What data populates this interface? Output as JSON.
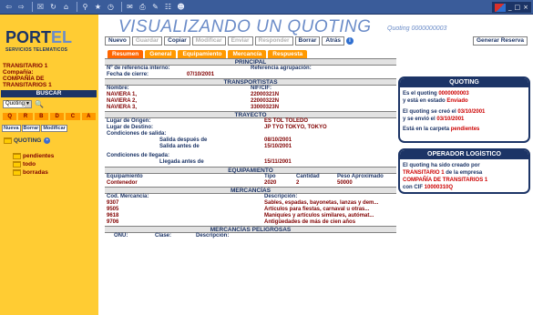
{
  "browser": {
    "toolbar_icons": [
      "back-icon",
      "forward-icon",
      "stop-icon",
      "refresh-icon",
      "home-icon",
      "search-icon",
      "favorites-icon",
      "history-icon",
      "mail-icon",
      "print-icon",
      "edit-icon",
      "discuss-icon",
      "messenger-icon"
    ],
    "window_controls": [
      "_",
      "□",
      "×"
    ]
  },
  "sidebar": {
    "logo_text_1": "PORT",
    "logo_text_2": "EL",
    "logo_subtitle": "SERVICIOS TELEMATICOS",
    "user_line1": "TRANSITARIO 1",
    "user_line2": "Compañía:",
    "user_line3": "COMPAÑÍA DE",
    "user_line4": "TRANSITARIOS 1",
    "buscar_label": "BUSCAR",
    "search_select_value": "Quotings",
    "letters": [
      "Q",
      "R",
      "B",
      "D",
      "C",
      "A"
    ],
    "buttons": [
      "Nueva",
      "Borrar",
      "Modificar"
    ],
    "tree_root": "QUOTING",
    "tree_items": [
      "pendientes",
      "todo",
      "borradas"
    ]
  },
  "header": {
    "title": "VISUALIZANDO UN QUOTING",
    "quoting_number": "Quoting 0000000003"
  },
  "actions": {
    "nuevo": "Nuevo",
    "guardar": "Guardar",
    "copiar": "Copiar",
    "modificar": "Modificar",
    "enviar": "Enviar",
    "responder": "Responder",
    "borrar": "Borrar",
    "atras": "Atrás",
    "info": "i",
    "generar_reserva": "Generar Reserva"
  },
  "tabs": [
    "Resumen",
    "General",
    "Equipamiento",
    "Mercancía",
    "Respuesta"
  ],
  "main": {
    "principal": {
      "header": "PRINCIPAL",
      "ref_interno_label": "Nº de referencia interno:",
      "ref_agrupacion_label": "Referencia agrupación:",
      "fecha_cierre_label": "Fecha de cierre:",
      "fecha_cierre_value": "07/10/2001"
    },
    "transportistas": {
      "header": "TRANSPORTISTAS",
      "col_nombre": "Nombre:",
      "col_nif": "NIF/CIF:",
      "rows": [
        {
          "nombre": "NAVIERA 1,",
          "nif": "22000321N"
        },
        {
          "nombre": "NAVIERA 2,",
          "nif": "22000322N"
        },
        {
          "nombre": "NAVIERA 3,",
          "nif": "33000323N"
        }
      ]
    },
    "trayecto": {
      "header": "TRAYECTO",
      "origen_label": "Lugar de Origen:",
      "origen_value": "ES TOL TOLEDO",
      "destino_label": "Lugar de Destino:",
      "destino_value": "JP TYO TOKYO, TOKYO",
      "cond_salida_label": "Condiciones de salida:",
      "salida_despues_label": "Salida después de",
      "salida_despues_value": "08/10/2001",
      "salida_antes_label": "Salida antes de",
      "salida_antes_value": "15/10/2001",
      "cond_llegada_label": "Condiciones de llegada:",
      "llegada_antes_label": "Llegada antes de",
      "llegada_antes_value": "15/11/2001"
    },
    "equipamiento": {
      "header": "EQUIPAMIENTO",
      "col_equip": "Equipamiento",
      "col_tipo": "Tipo",
      "col_cantidad": "Cantidad",
      "col_peso": "Peso Aproximado",
      "row_equip": "Contenedor",
      "row_tipo": "2020",
      "row_cantidad": "2",
      "row_peso": "50000"
    },
    "mercancias": {
      "header": "MERCANCÍAS",
      "col_cod": "Cod. Mercancía:",
      "col_desc": "Descripción:",
      "rows": [
        {
          "cod": "9307",
          "desc": "Sables, espadas, bayonetas, lanzas y dem..."
        },
        {
          "cod": "9505",
          "desc": "Artículos para fiestas, carnaval u otras..."
        },
        {
          "cod": "9618",
          "desc": "Maniquíes y artículos similares, autómat..."
        },
        {
          "cod": "9706",
          "desc": "Antigüedades de más de cien años"
        }
      ]
    },
    "peligrosas": {
      "header": "MERCANCÍAS PELIGROSAS",
      "col_onu": "ONU:",
      "col_clase": "Clase:",
      "col_desc": "Descripción:"
    }
  },
  "panel_quoting": {
    "header": "QUOTING",
    "line1a": "Es el quoting ",
    "line1b": "0000000003",
    "line2a": "y está en estado ",
    "line2b": "Enviado",
    "line3a": "El quoting se creó el ",
    "line3b": "03/10/2001",
    "line4a": "y se envió el ",
    "line4b": "03/10/2001",
    "line5a": "Está en la carpeta ",
    "line5b": "pendientes"
  },
  "panel_operador": {
    "header": "OPERADOR LOGÍSTICO",
    "line1": "El quoting ha sido creado por",
    "line2a": "TRANSITARIO 1",
    "line2b": " de la empresa",
    "line3": "COMPAÑÍA DE TRANSITARIOS 1",
    "line4a": "con CIF ",
    "line4b": "10000310Q"
  },
  "colors": {
    "sidebar_bg": "#ffcc33",
    "navy": "#1c3466",
    "maroon": "#800000",
    "tab_orange": "#ff9900",
    "title_blue": "#6b8cc8"
  }
}
